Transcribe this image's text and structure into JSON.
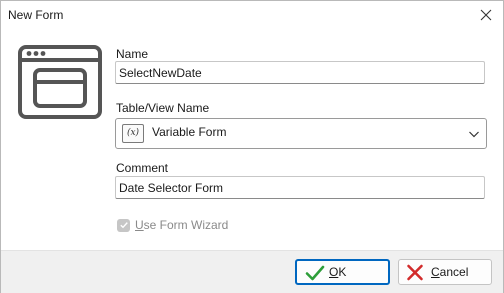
{
  "window": {
    "title": "New Form"
  },
  "form": {
    "name_label": "Name",
    "name_value": "SelectNewDate",
    "table_label": "Table/View Name",
    "table_icon_text": "(x)",
    "table_value": "Variable Form",
    "comment_label": "Comment",
    "comment_value": "Date Selector Form",
    "wizard_label": "Use Form Wizard",
    "wizard_checked": true,
    "wizard_enabled": false
  },
  "buttons": {
    "ok_accel": "O",
    "ok_rest": "K",
    "cancel_accel": "C",
    "cancel_rest": "ancel"
  },
  "colors": {
    "ok_check": "#2e9e3a",
    "cancel_x": "#d22b2b",
    "focus_border": "#0067c0"
  },
  "icons": [
    "close-icon",
    "form-window-icon",
    "variable-icon",
    "chevron-down-icon",
    "checkmark-icon",
    "cancel-x-icon"
  ]
}
